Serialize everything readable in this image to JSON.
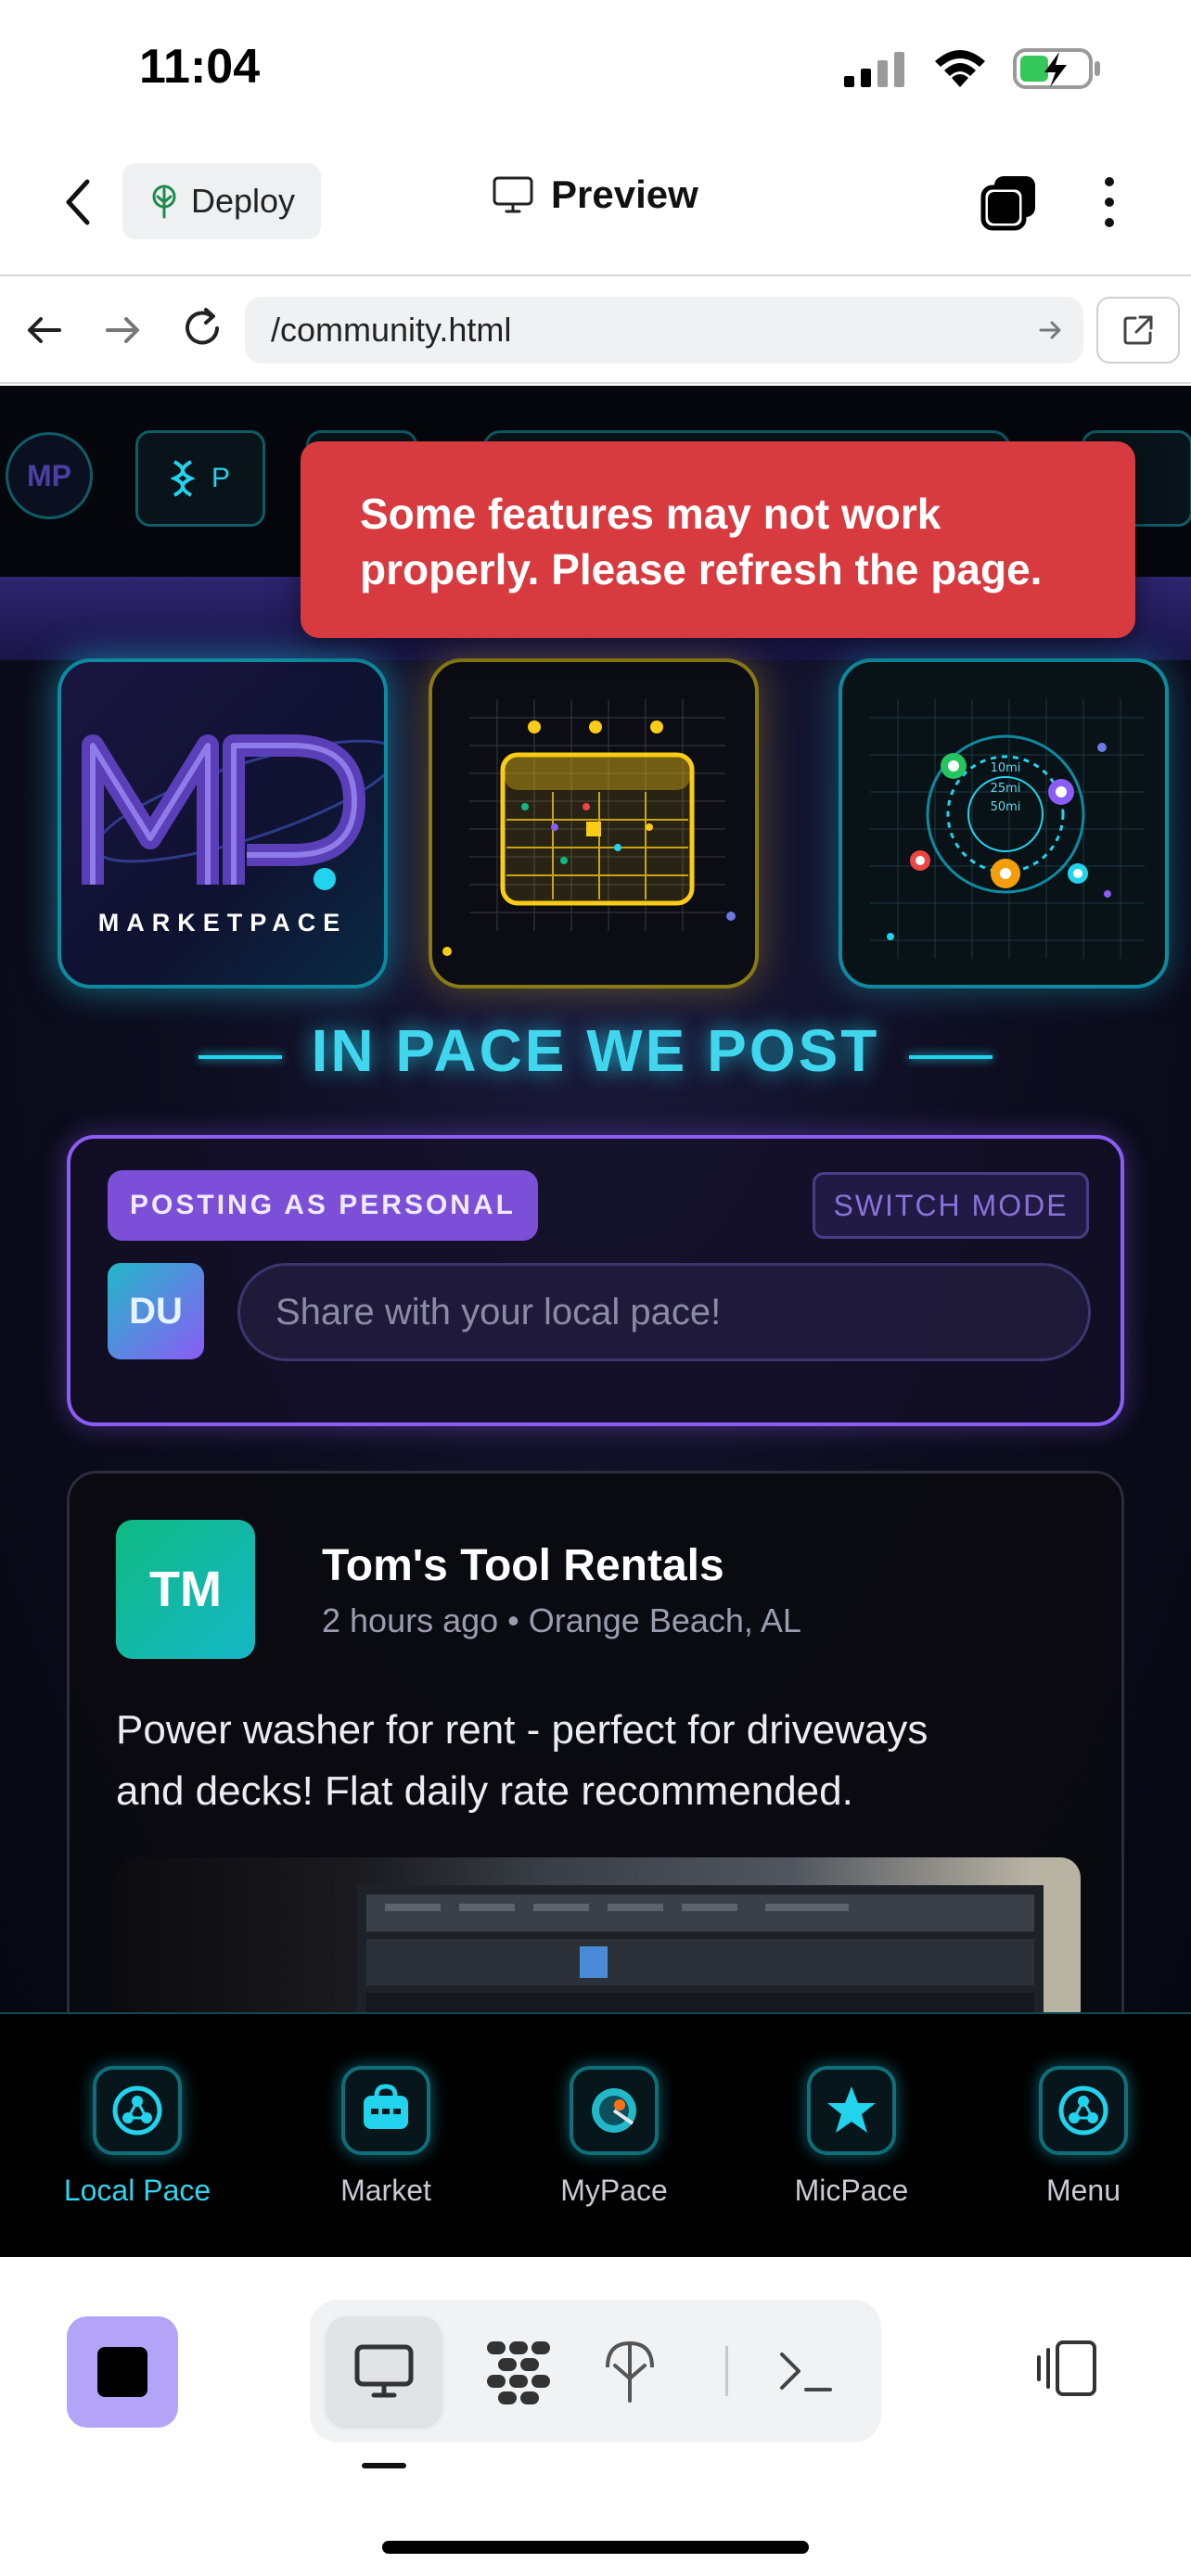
{
  "status_bar": {
    "time": "11:04"
  },
  "app_header": {
    "deploy_label": "Deploy",
    "preview_label": "Preview"
  },
  "browser": {
    "url": "/community.html"
  },
  "site": {
    "nav_chip_letter": "P",
    "logo_initials": "MP",
    "alert_line1": "Some features may not work",
    "alert_line2": "properly. Please refresh the page.",
    "logo_tile_text": "MARKETPACE",
    "radar_labels": [
      "10mi",
      "25mi",
      "50mi"
    ],
    "tagline": "IN PACE WE POST",
    "compose": {
      "posting_as": "POSTING AS PERSONAL",
      "switch_mode": "SWITCH MODE",
      "avatar_initials": "DU",
      "placeholder": "Share with your local pace!"
    },
    "post": {
      "avatar_initials": "TM",
      "author": "Tom's Tool Rentals",
      "meta": "2 hours ago • Orange Beach, AL",
      "body_line1": "Power washer for rent - perfect for driveways",
      "body_line2": "and decks! Flat daily rate recommended."
    },
    "tabs": [
      {
        "label": "Local Pace",
        "icon": "local-pace-icon",
        "active": true
      },
      {
        "label": "Market",
        "icon": "market-icon",
        "active": false
      },
      {
        "label": "MyPace",
        "icon": "mypace-icon",
        "active": false
      },
      {
        "label": "MicPace",
        "icon": "star-icon",
        "active": false
      },
      {
        "label": "Menu",
        "icon": "menu-icon",
        "active": false
      }
    ]
  },
  "colors": {
    "accent_cyan": "#22d3ee",
    "accent_purple": "#8b5cf6",
    "alert_red": "#d73a3f",
    "stop_button": "#b4a4f8"
  }
}
